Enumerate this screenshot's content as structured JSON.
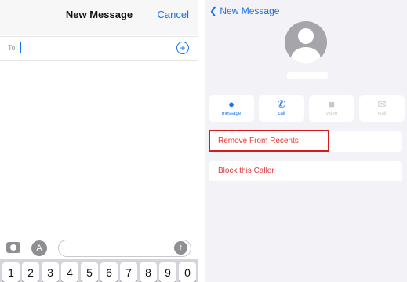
{
  "left": {
    "title": "New Message",
    "cancel_label": "Cancel",
    "to_label": "To:",
    "plus_icon": "+",
    "appstore_icon": "A",
    "send_icon": "↑",
    "keys": [
      "1",
      "2",
      "3",
      "4",
      "5",
      "6",
      "7",
      "8",
      "9",
      "0"
    ]
  },
  "right": {
    "back_label": "New Message",
    "actions": [
      {
        "label": "message",
        "icon": "●",
        "enabled": true
      },
      {
        "label": "call",
        "icon": "✆",
        "enabled": true
      },
      {
        "label": "video",
        "icon": "■",
        "enabled": false
      },
      {
        "label": "mail",
        "icon": "✉",
        "enabled": false
      }
    ],
    "remove_from_recents": "Remove From Recents",
    "block_caller": "Block this Caller"
  },
  "colors": {
    "accent": "#1a73e8",
    "destructive": "#e53935",
    "highlight_box": "#d71920"
  }
}
